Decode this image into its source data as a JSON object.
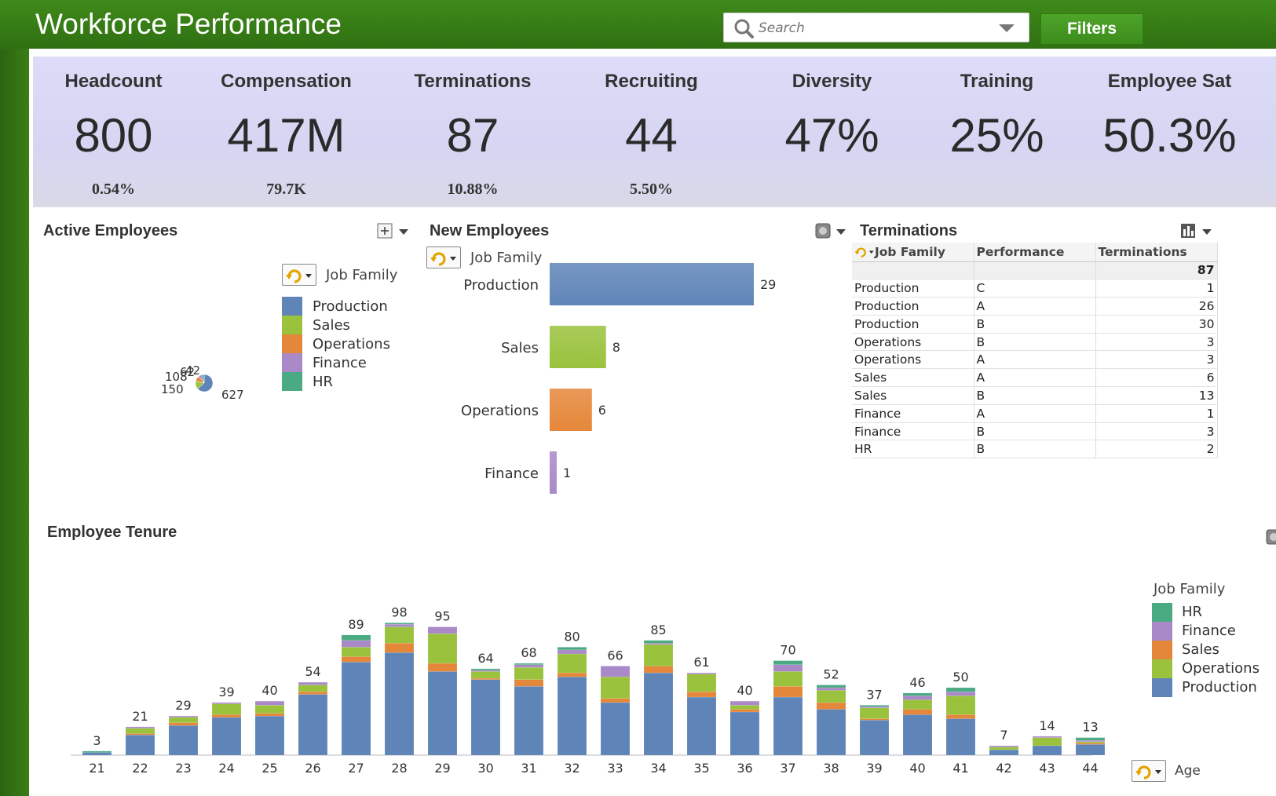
{
  "header": {
    "title": "Workforce Performance",
    "search_placeholder": "Search",
    "filters_label": "Filters"
  },
  "kpis": [
    {
      "label": "Headcount",
      "value": "800",
      "sub": "0.54%"
    },
    {
      "label": "Compensation",
      "value": "417M",
      "sub": "79.7K"
    },
    {
      "label": "Terminations",
      "value": "87",
      "sub": "10.88%"
    },
    {
      "label": "Recruiting",
      "value": "44",
      "sub": "5.50%"
    },
    {
      "label": "Diversity",
      "value": "47%",
      "sub": ""
    },
    {
      "label": "Training",
      "value": "25%",
      "sub": ""
    },
    {
      "label": "Employee Sat",
      "value": "50.3%",
      "sub": ""
    }
  ],
  "colors": {
    "Production": "#5f85b8",
    "Sales": "#9ac23d",
    "Operations": "#e5873a",
    "Finance": "#a989c8",
    "HR": "#4aaa82"
  },
  "active_employees": {
    "title": "Active Employees",
    "legend_title": "Job Family",
    "legend": [
      "Production",
      "Sales",
      "Operations",
      "Finance",
      "HR"
    ],
    "pie_labels": [
      "108",
      "62",
      "42",
      "150",
      "627"
    ]
  },
  "new_employees": {
    "title": "New Employees",
    "dimension_label": "Job Family"
  },
  "terminations": {
    "title": "Terminations",
    "columns": [
      "Job Family",
      "Performance",
      "Terminations"
    ],
    "total": "87",
    "rows": [
      [
        "Production",
        "C",
        "1"
      ],
      [
        "Production",
        "A",
        "26"
      ],
      [
        "Production",
        "B",
        "30"
      ],
      [
        "Operations",
        "B",
        "3"
      ],
      [
        "Operations",
        "A",
        "3"
      ],
      [
        "Sales",
        "A",
        "6"
      ],
      [
        "Sales",
        "B",
        "13"
      ],
      [
        "Finance",
        "A",
        "1"
      ],
      [
        "Finance",
        "B",
        "3"
      ],
      [
        "HR",
        "B",
        "2"
      ]
    ]
  },
  "tenure": {
    "title": "Employee Tenure",
    "legend_title": "Job Family",
    "legend": [
      "HR",
      "Finance",
      "Sales",
      "Operations",
      "Production"
    ],
    "dimension_label": "Age"
  },
  "chart_data": [
    {
      "type": "pie",
      "title": "Active Employees",
      "legend_title": "Job Family",
      "categories": [
        "Production",
        "Sales",
        "Operations",
        "Finance",
        "HR"
      ],
      "values": [
        627,
        150,
        108,
        62,
        42
      ]
    },
    {
      "type": "bar",
      "orientation": "horizontal",
      "title": "New Employees",
      "categories": [
        "Production",
        "Sales",
        "Operations",
        "Finance"
      ],
      "values": [
        29,
        8,
        6,
        1
      ]
    },
    {
      "type": "bar",
      "stacked": true,
      "title": "Employee Tenure",
      "xlabel": "Age",
      "legend_title": "Job Family",
      "categories": [
        "21",
        "22",
        "23",
        "24",
        "25",
        "26",
        "27",
        "28",
        "29",
        "30",
        "31",
        "32",
        "33",
        "34",
        "35",
        "36",
        "37",
        "38",
        "39",
        "40",
        "41",
        "42",
        "43",
        "44"
      ],
      "totals": [
        3,
        21,
        29,
        39,
        40,
        54,
        89,
        98,
        95,
        64,
        68,
        80,
        66,
        85,
        61,
        40,
        70,
        52,
        37,
        46,
        50,
        7,
        14,
        13
      ],
      "series": [
        {
          "name": "Production",
          "values": [
            2,
            15,
            22,
            28,
            29,
            45,
            69,
            76,
            62,
            56,
            51,
            58,
            39,
            61,
            43,
            32,
            43,
            34,
            26,
            30,
            27,
            4,
            7,
            8
          ]
        },
        {
          "name": "Operations",
          "values": [
            0,
            1,
            2,
            2,
            2,
            2,
            4,
            7,
            6,
            1,
            5,
            3,
            3,
            5,
            4,
            2,
            8,
            5,
            1,
            4,
            3,
            0,
            0,
            1
          ]
        },
        {
          "name": "Sales",
          "values": [
            0,
            4,
            4,
            8,
            6,
            5,
            7,
            12,
            22,
            5,
            9,
            14,
            16,
            16,
            13,
            3,
            11,
            9,
            8,
            7,
            14,
            2,
            6,
            1
          ]
        },
        {
          "name": "Finance",
          "values": [
            0,
            1,
            1,
            1,
            3,
            2,
            5,
            2,
            5,
            1,
            2,
            3,
            8,
            1,
            1,
            3,
            5,
            2,
            1,
            3,
            3,
            1,
            1,
            1
          ]
        },
        {
          "name": "HR",
          "values": [
            1,
            0,
            0,
            0,
            0,
            0,
            4,
            1,
            0,
            1,
            1,
            2,
            0,
            2,
            0,
            0,
            3,
            2,
            1,
            2,
            3,
            0,
            0,
            2
          ]
        }
      ]
    }
  ]
}
